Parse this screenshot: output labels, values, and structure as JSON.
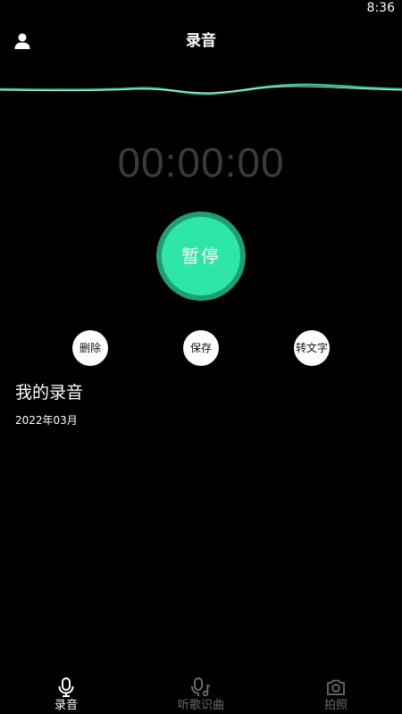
{
  "status_bar": {
    "time": "8:36"
  },
  "header": {
    "title": "录音",
    "profile_icon": "person-icon"
  },
  "recorder": {
    "timer": "00:00:00",
    "pause_label": "暂停",
    "accent_color": "#2ee6a6"
  },
  "actions": {
    "delete_label": "删除",
    "save_label": "保存",
    "transcribe_label": "转文字"
  },
  "recordings": {
    "section_title": "我的录音",
    "month": "2022年03月"
  },
  "bottom_nav": {
    "items": [
      {
        "label": "录音",
        "icon": "microphone-icon",
        "active": true
      },
      {
        "label": "听歌识曲",
        "icon": "music-mic-icon",
        "active": false
      },
      {
        "label": "拍照",
        "icon": "camera-icon",
        "active": false
      }
    ]
  }
}
